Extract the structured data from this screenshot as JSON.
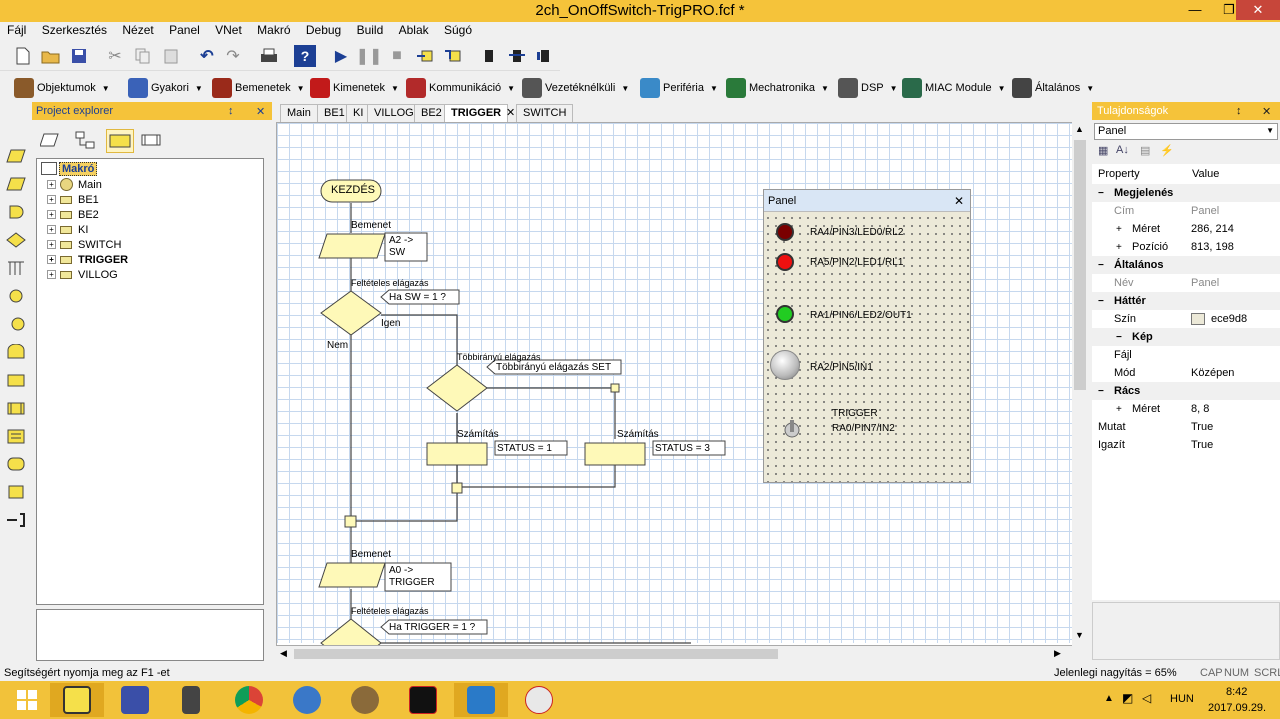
{
  "window": {
    "title": "2ch_OnOffSwitch-TrigPRO.fcf *",
    "minimize": "—",
    "restore": "❐",
    "close": "✕"
  },
  "menu": [
    "Fájl",
    "Szerkesztés",
    "Nézet",
    "Panel",
    "VNet",
    "Makró",
    "Debug",
    "Build",
    "Ablak",
    "Súgó"
  ],
  "toolbar2": [
    {
      "label": "Objektumok",
      "color": "#8a5a2a"
    },
    {
      "label": "Gyakori",
      "color": "#3a62b8"
    },
    {
      "label": "Bemenetek",
      "color": "#9a2a1a"
    },
    {
      "label": "Kimenetek",
      "color": "#c21a1a"
    },
    {
      "label": "Kommunikáció",
      "color": "#b22a2a"
    },
    {
      "label": "Vezetéknélküli",
      "color": "#555555"
    },
    {
      "label": "Periféria",
      "color": "#3a8ac8"
    },
    {
      "label": "Mechatronika",
      "color": "#2a7a3a"
    },
    {
      "label": "DSP",
      "color": "#555555"
    },
    {
      "label": "MIAC Module",
      "color": "#2a6a4a"
    },
    {
      "label": "Általános",
      "color": "#444444"
    }
  ],
  "explorer": {
    "title": "Project explorer",
    "pin": "↕",
    "close": "✕",
    "root": "Makró",
    "items": [
      {
        "label": "Main",
        "bold": false,
        "main": true
      },
      {
        "label": "BE1",
        "bold": false
      },
      {
        "label": "BE2",
        "bold": false
      },
      {
        "label": "KI",
        "bold": false
      },
      {
        "label": "SWITCH",
        "bold": false
      },
      {
        "label": "TRIGGER",
        "bold": true
      },
      {
        "label": "VILLOG",
        "bold": false
      }
    ]
  },
  "tabs": [
    "Main",
    "BE1",
    "KI",
    "VILLOG",
    "BE2",
    "TRIGGER",
    "SWITCH"
  ],
  "tab_close": "✕",
  "flow": {
    "start": "KEZDÉS",
    "input1_title": "Bemenet",
    "input1_text": "A2 -> SW",
    "dec1_title": "Feltételes elágazás",
    "dec1_text": "Ha SW = 1 ?",
    "yes": "Igen",
    "no": "Nem",
    "switch_title": "Többirányú elágazás",
    "switch_text": "Többirányú elágazás SET",
    "calc1_title": "Számítás",
    "calc1_text": "STATUS = 1",
    "calc2_title": "Számítás",
    "calc2_text": "STATUS = 3",
    "input2_title": "Bemenet",
    "input2_text": "A0 -> TRIGGER",
    "dec2_title": "Feltételes elágazás",
    "dec2_text": "Ha TRIGGER = 1 ?"
  },
  "panel": {
    "title": "Panel",
    "close": "✕",
    "leds": [
      {
        "label": "RA4/PIN3/LED0/RL2",
        "color": "#7a0000"
      },
      {
        "label": "RA5/PIN2/LED1/RL1",
        "color": "#ee1010"
      },
      {
        "label": "RA1/PIN6/LED2/OUT1",
        "color": "#22cc22"
      }
    ],
    "button_label": "RA2/PIN5/IN1",
    "switch_label1": "TRIGGER",
    "switch_label2": "RA0/PIN7/IN2"
  },
  "properties": {
    "title": "Tulajdonságok",
    "pin": "↕",
    "close": "✕",
    "selector": "Panel",
    "col_property": "Property",
    "col_value": "Value",
    "rows": [
      {
        "type": "cat",
        "key": "Megjelenés",
        "exp": "−"
      },
      {
        "type": "row",
        "key": "Cím",
        "value": "Panel",
        "grey": true
      },
      {
        "type": "row",
        "key": "Méret",
        "value": "286, 214",
        "exp": "+"
      },
      {
        "type": "row",
        "key": "Pozíció",
        "value": "813, 198",
        "exp": "+"
      },
      {
        "type": "cat",
        "key": "Általános",
        "exp": "−"
      },
      {
        "type": "row",
        "key": "Név",
        "value": "Panel",
        "grey": true
      },
      {
        "type": "cat",
        "key": "Háttér",
        "exp": "−"
      },
      {
        "type": "row",
        "key": "Szín",
        "value": "ece9d8",
        "swatch": "#ece9d8"
      },
      {
        "type": "cat",
        "key": "Kép",
        "exp": "−"
      },
      {
        "type": "row",
        "key": "Fájl",
        "value": ""
      },
      {
        "type": "row",
        "key": "Mód",
        "value": "Középen"
      },
      {
        "type": "cat",
        "key": "Rács",
        "exp": "−"
      },
      {
        "type": "row",
        "key": "Méret",
        "value": "8, 8",
        "exp": "+"
      },
      {
        "type": "row",
        "key": "Mutat",
        "value": "True"
      },
      {
        "type": "row",
        "key": "Igazít",
        "value": "True"
      }
    ]
  },
  "status": {
    "left": "Segítségért nyomja meg az F1 -et",
    "zoom": "Jelenlegi nagyítás = 65%",
    "caps": "CAP",
    "num": "NUM",
    "scrl": "SCRL"
  },
  "taskbar": {
    "lang": "HUN",
    "time": "8:42",
    "date": "2017.09.29."
  }
}
